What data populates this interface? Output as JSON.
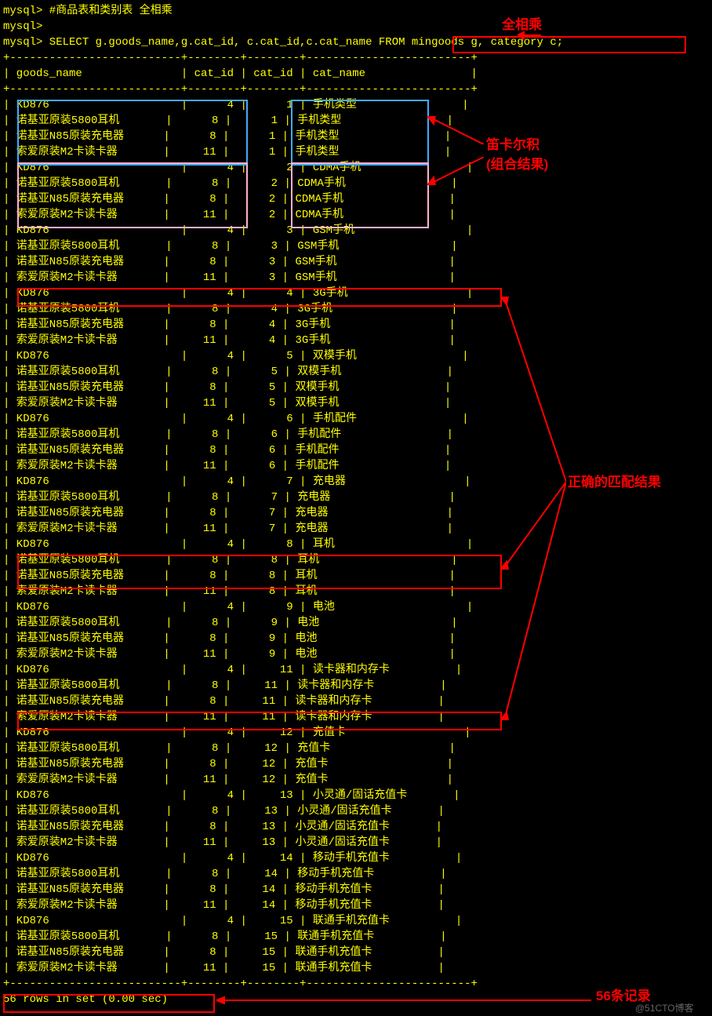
{
  "prompts": {
    "p1": "mysql> #商品表和类别表 全相乘",
    "p2": "mysql>",
    "p3_prefix": "mysql> SELECT g.goods_name,g.cat_id, c.cat_id,c.cat_name ",
    "p3_from": "FROM mingoods g, category c;"
  },
  "headers": {
    "sep": "+--------------------------+--------+--------+-------------------------+",
    "row": "| goods_name               | cat_id | cat_id | cat_name                |"
  },
  "annotations": {
    "a1": "全相乘",
    "a2": "笛卡尔积",
    "a3": "(组合结果)",
    "a4": "正确的匹配结果",
    "a5": "56条记录"
  },
  "footer": "56 rows in set (0.00 sec)",
  "watermark": "@51CTO博客",
  "chart_data": {
    "type": "table",
    "columns": [
      "goods_name",
      "cat_id",
      "cat_id",
      "cat_name"
    ],
    "rows": [
      [
        "KD876",
        4,
        1,
        "手机类型"
      ],
      [
        "诺基亚原装5800耳机",
        8,
        1,
        "手机类型"
      ],
      [
        "诺基亚N85原装充电器",
        8,
        1,
        "手机类型"
      ],
      [
        "索爱原装M2卡读卡器",
        11,
        1,
        "手机类型"
      ],
      [
        "KD876",
        4,
        2,
        "CDMA手机"
      ],
      [
        "诺基亚原装5800耳机",
        8,
        2,
        "CDMA手机"
      ],
      [
        "诺基亚N85原装充电器",
        8,
        2,
        "CDMA手机"
      ],
      [
        "索爱原装M2卡读卡器",
        11,
        2,
        "CDMA手机"
      ],
      [
        "KD876",
        4,
        3,
        "GSM手机"
      ],
      [
        "诺基亚原装5800耳机",
        8,
        3,
        "GSM手机"
      ],
      [
        "诺基亚N85原装充电器",
        8,
        3,
        "GSM手机"
      ],
      [
        "索爱原装M2卡读卡器",
        11,
        3,
        "GSM手机"
      ],
      [
        "KD876",
        4,
        4,
        "3G手机"
      ],
      [
        "诺基亚原装5800耳机",
        8,
        4,
        "3G手机"
      ],
      [
        "诺基亚N85原装充电器",
        8,
        4,
        "3G手机"
      ],
      [
        "索爱原装M2卡读卡器",
        11,
        4,
        "3G手机"
      ],
      [
        "KD876",
        4,
        5,
        "双模手机"
      ],
      [
        "诺基亚原装5800耳机",
        8,
        5,
        "双模手机"
      ],
      [
        "诺基亚N85原装充电器",
        8,
        5,
        "双模手机"
      ],
      [
        "索爱原装M2卡读卡器",
        11,
        5,
        "双模手机"
      ],
      [
        "KD876",
        4,
        6,
        "手机配件"
      ],
      [
        "诺基亚原装5800耳机",
        8,
        6,
        "手机配件"
      ],
      [
        "诺基亚N85原装充电器",
        8,
        6,
        "手机配件"
      ],
      [
        "索爱原装M2卡读卡器",
        11,
        6,
        "手机配件"
      ],
      [
        "KD876",
        4,
        7,
        "充电器"
      ],
      [
        "诺基亚原装5800耳机",
        8,
        7,
        "充电器"
      ],
      [
        "诺基亚N85原装充电器",
        8,
        7,
        "充电器"
      ],
      [
        "索爱原装M2卡读卡器",
        11,
        7,
        "充电器"
      ],
      [
        "KD876",
        4,
        8,
        "耳机"
      ],
      [
        "诺基亚原装5800耳机",
        8,
        8,
        "耳机"
      ],
      [
        "诺基亚N85原装充电器",
        8,
        8,
        "耳机"
      ],
      [
        "索爱原装M2卡读卡器",
        11,
        8,
        "耳机"
      ],
      [
        "KD876",
        4,
        9,
        "电池"
      ],
      [
        "诺基亚原装5800耳机",
        8,
        9,
        "电池"
      ],
      [
        "诺基亚N85原装充电器",
        8,
        9,
        "电池"
      ],
      [
        "索爱原装M2卡读卡器",
        11,
        9,
        "电池"
      ],
      [
        "KD876",
        4,
        11,
        "读卡器和内存卡"
      ],
      [
        "诺基亚原装5800耳机",
        8,
        11,
        "读卡器和内存卡"
      ],
      [
        "诺基亚N85原装充电器",
        8,
        11,
        "读卡器和内存卡"
      ],
      [
        "索爱原装M2卡读卡器",
        11,
        11,
        "读卡器和内存卡"
      ],
      [
        "KD876",
        4,
        12,
        "充值卡"
      ],
      [
        "诺基亚原装5800耳机",
        8,
        12,
        "充值卡"
      ],
      [
        "诺基亚N85原装充电器",
        8,
        12,
        "充值卡"
      ],
      [
        "索爱原装M2卡读卡器",
        11,
        12,
        "充值卡"
      ],
      [
        "KD876",
        4,
        13,
        "小灵通/固话充值卡"
      ],
      [
        "诺基亚原装5800耳机",
        8,
        13,
        "小灵通/固话充值卡"
      ],
      [
        "诺基亚N85原装充电器",
        8,
        13,
        "小灵通/固话充值卡"
      ],
      [
        "索爱原装M2卡读卡器",
        11,
        13,
        "小灵通/固话充值卡"
      ],
      [
        "KD876",
        4,
        14,
        "移动手机充值卡"
      ],
      [
        "诺基亚原装5800耳机",
        8,
        14,
        "移动手机充值卡"
      ],
      [
        "诺基亚N85原装充电器",
        8,
        14,
        "移动手机充值卡"
      ],
      [
        "索爱原装M2卡读卡器",
        11,
        14,
        "移动手机充值卡"
      ],
      [
        "KD876",
        4,
        15,
        "联通手机充值卡"
      ],
      [
        "诺基亚原装5800耳机",
        8,
        15,
        "联通手机充值卡"
      ],
      [
        "诺基亚N85原装充电器",
        8,
        15,
        "联通手机充值卡"
      ],
      [
        "索爱原装M2卡读卡器",
        11,
        15,
        "联通手机充值卡"
      ]
    ]
  }
}
